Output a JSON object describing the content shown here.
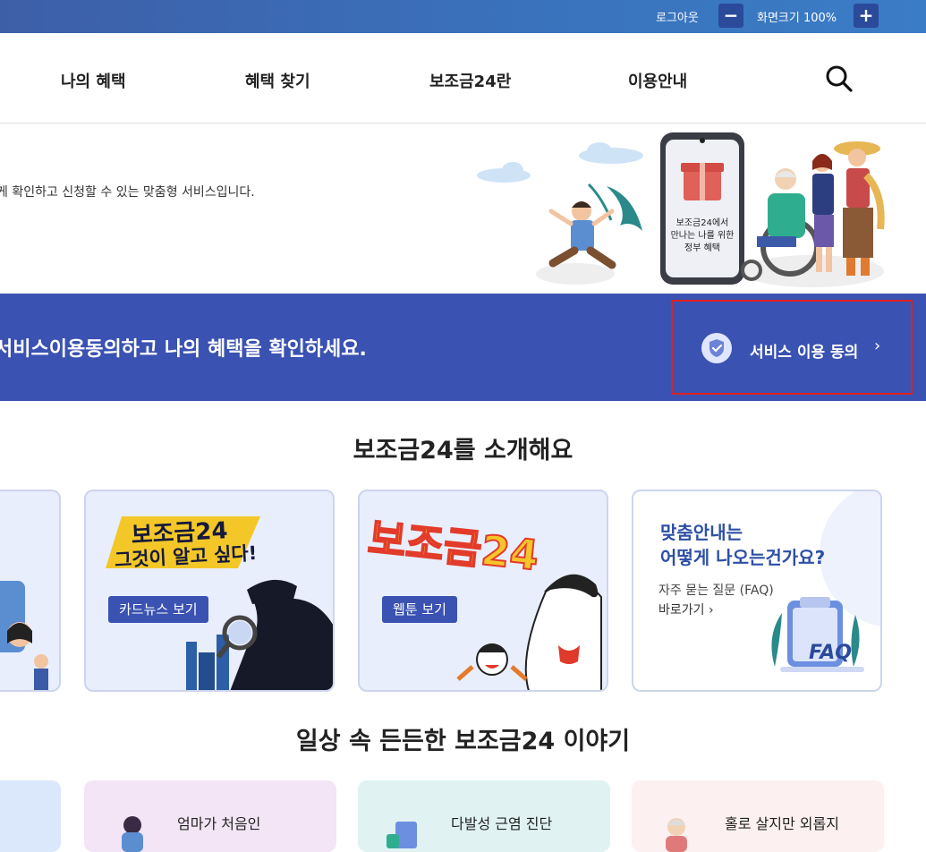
{
  "topbar": {
    "logout": "로그아웃",
    "zoom_minus": "−",
    "zoom_label": "화면크기 100%",
    "zoom_plus": "+"
  },
  "nav": {
    "items": [
      "나의 혜택",
      "혜택 찾기",
      "보조금24란",
      "이용안내"
    ]
  },
  "hero": {
    "description": "게 확인하고 신청할 수 있는 맞춤형 서비스입니다.",
    "phone_text": [
      "보조금24에서",
      "만나는 나를 위한",
      "정부 혜택"
    ]
  },
  "consent": {
    "message": "서비스이용동의하고 나의 혜택을 확인하세요.",
    "button": "서비스 이용 동의"
  },
  "intro": {
    "title": "보조금24를 소개해요",
    "cards": [
      {
        "headline_1": "보조금24",
        "headline_2": "그것이 알고 싶다!",
        "button": "카드뉴스 보기"
      },
      {
        "headline": "보조금24",
        "button": "웹툰 보기"
      },
      {
        "title_1": "맞춤안내는",
        "title_2": "어떻게 나오는건가요?",
        "sub": "자주 묻는 질문 (FAQ)",
        "link": "바로가기",
        "faq_badge": "FAQ"
      }
    ]
  },
  "stories": {
    "title": "일상 속 든든한 보조금24 이야기",
    "items": [
      "엄마가 처음인",
      "다발성 근염 진단",
      "홀로 살지만 외롭지"
    ]
  },
  "colors": {
    "brand_blue": "#3a52b1",
    "highlight_red": "#e02020",
    "faq_blue": "#2d4fa5"
  }
}
